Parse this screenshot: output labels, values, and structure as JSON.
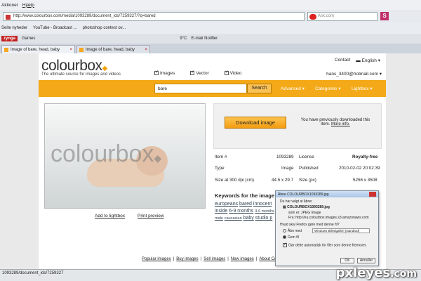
{
  "browser": {
    "menu": [
      "Aktioner",
      "Hjælp"
    ],
    "url": "http://www.colourbox.com/media/1093289/document_ids/7259327/?q=bared",
    "search_placeholder": "Ask.com",
    "bookmarks": [
      "Seite nyheder",
      "YouTube - Broadcast ...",
      "photoshop contest ov..."
    ],
    "toolbar2_items": [
      "zynga",
      "Games",
      "9°C",
      "E-mail Notifier"
    ],
    "tabs": [
      "Image of bare, head, baby",
      "Image of bare, head, baby"
    ],
    "status": "1093289/document_ids/7259327"
  },
  "site": {
    "logo": "colourbox",
    "tagline": "The ultimate source for images and videos",
    "contact": "Contact",
    "language": "English",
    "user_email": "hans_3400@hotmail.com",
    "filters": [
      "Images",
      "Vector",
      "Video"
    ],
    "search_value": "bare",
    "search_button": "Search",
    "nav": [
      "Advanced",
      "Categories",
      "Lightbox"
    ],
    "watermark": "colourbox",
    "photo_links": [
      "Add to lightbox",
      "Print preview"
    ],
    "download_button": "Download image",
    "download_note": "You have previously downloaded this item.",
    "more_info": "More info.",
    "info": [
      {
        "label": "Item #",
        "value": "1093289"
      },
      {
        "label": "Type",
        "value": "Image"
      },
      {
        "label": "Size at 300 dpi (cm)",
        "value": "44.5 x 29.7"
      }
    ],
    "info_right": [
      {
        "label": "License",
        "value": "Royalty-free"
      },
      {
        "label": "Published",
        "value": "2010-02-02 20:02:39"
      },
      {
        "label": "Size (px)",
        "value": "5256 x 3508"
      }
    ],
    "keywords_title": "Keywords for the image \"",
    "keywords": [
      "europeans",
      "bared",
      "innocent",
      "inside",
      "6-9 months",
      "3-6 months",
      "male",
      "caucasian",
      "baby",
      "studio p"
    ],
    "footer_links": [
      "Popular images",
      "Buy images",
      "Sell images",
      "New images",
      "About Colourbox"
    ]
  },
  "dialog": {
    "title": "Åbne COLOURBOX1093289.jpg",
    "intro": "Du har valgt at åbne:",
    "filename": "COLOURBOX1093289.jpg",
    "type": "som er: JPEG Image",
    "from": "Fra: http://eu.colourbox.images.s3.amazonaws.com",
    "question": "Hvad skal Firefox gøre med denne fil?",
    "open_with": "Åbn med",
    "app": "Windows Billedgalleri (standard)",
    "save": "Gem fil",
    "always": "Gør dette automatisk for filer som denne fremover.",
    "ok": "OK",
    "cancel": "Annuller"
  },
  "watermark_badge": {
    "name": "pxleyes",
    "domain": ".com"
  }
}
